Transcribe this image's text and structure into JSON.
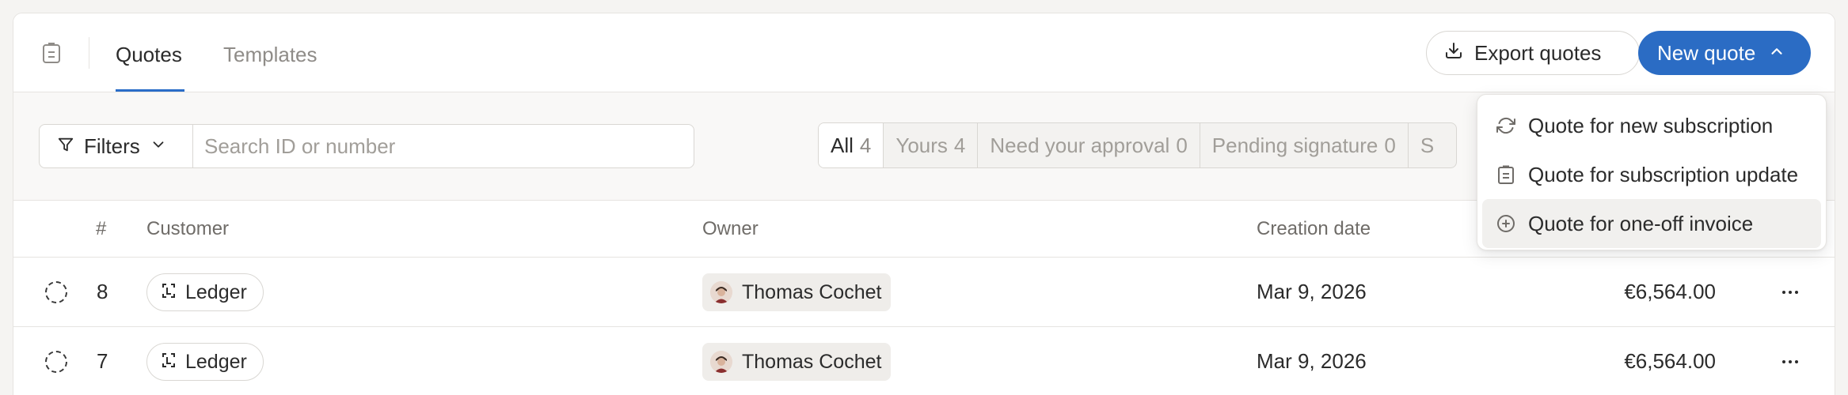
{
  "header": {
    "tabs": [
      {
        "label": "Quotes",
        "active": true
      },
      {
        "label": "Templates",
        "active": false
      }
    ],
    "export_label": "Export quotes",
    "new_quote_label": "New quote"
  },
  "toolbar": {
    "filters_label": "Filters",
    "search_placeholder": "Search ID or number",
    "segments": [
      {
        "label": "All",
        "count": "4",
        "active": true
      },
      {
        "label": "Yours",
        "count": "4",
        "active": false
      },
      {
        "label": "Need your approval",
        "count": "0",
        "active": false
      },
      {
        "label": "Pending signature",
        "count": "0",
        "active": false
      },
      {
        "label": "S",
        "count": "",
        "active": false
      }
    ]
  },
  "table": {
    "columns": {
      "number": "#",
      "customer": "Customer",
      "owner": "Owner",
      "creation_date": "Creation date"
    },
    "rows": [
      {
        "number": "8",
        "customer": "Ledger",
        "owner": "Thomas Cochet",
        "date": "Mar 9, 2026",
        "amount": "€6,564.00"
      },
      {
        "number": "7",
        "customer": "Ledger",
        "owner": "Thomas Cochet",
        "date": "Mar 9, 2026",
        "amount": "€6,564.00"
      }
    ]
  },
  "menu": {
    "items": [
      {
        "label": "Quote for new subscription",
        "icon": "refresh-icon"
      },
      {
        "label": "Quote for subscription update",
        "icon": "clipboard-icon"
      },
      {
        "label": "Quote for one-off invoice",
        "icon": "plus-circle-icon"
      }
    ]
  },
  "colors": {
    "accent": "#2b6cc4",
    "tab_underline": "#2a6dc8",
    "border": "#e6e4e1"
  }
}
